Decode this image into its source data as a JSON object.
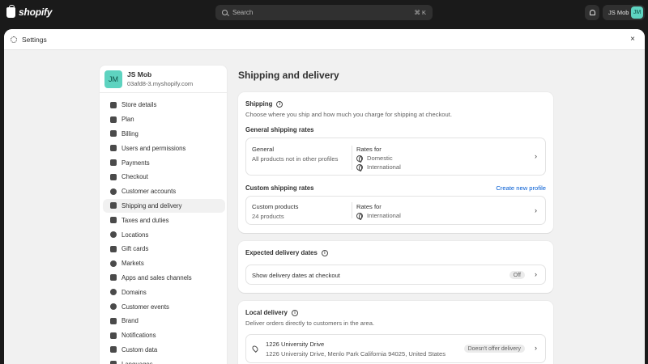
{
  "topbar": {
    "brand": "shopify",
    "search_placeholder": "Search",
    "search_shortcut": "⌘ K",
    "user_label": "JS Mob",
    "user_initials": "JM"
  },
  "modal": {
    "title": "Settings",
    "close": "×"
  },
  "sidebar": {
    "store": {
      "initials": "JM",
      "name": "JS Mob",
      "domain": "03afd8-3.myshopify.com"
    },
    "items": [
      {
        "label": "Store details",
        "icon": "store-icon"
      },
      {
        "label": "Plan",
        "icon": "plan-icon"
      },
      {
        "label": "Billing",
        "icon": "billing-icon"
      },
      {
        "label": "Users and permissions",
        "icon": "users-icon"
      },
      {
        "label": "Payments",
        "icon": "payments-icon"
      },
      {
        "label": "Checkout",
        "icon": "cart-icon"
      },
      {
        "label": "Customer accounts",
        "icon": "person-icon"
      },
      {
        "label": "Shipping and delivery",
        "icon": "truck-icon",
        "active": true
      },
      {
        "label": "Taxes and duties",
        "icon": "tax-icon"
      },
      {
        "label": "Locations",
        "icon": "location-icon"
      },
      {
        "label": "Gift cards",
        "icon": "gift-icon"
      },
      {
        "label": "Markets",
        "icon": "globe-icon"
      },
      {
        "label": "Apps and sales channels",
        "icon": "apps-icon"
      },
      {
        "label": "Domains",
        "icon": "globe-icon"
      },
      {
        "label": "Customer events",
        "icon": "events-icon"
      },
      {
        "label": "Brand",
        "icon": "brand-icon"
      },
      {
        "label": "Notifications",
        "icon": "bell-icon"
      },
      {
        "label": "Custom data",
        "icon": "data-icon"
      },
      {
        "label": "Languages",
        "icon": "language-icon"
      }
    ]
  },
  "main": {
    "title": "Shipping and delivery",
    "shipping": {
      "title": "Shipping",
      "subtitle": "Choose where you ship and how much you charge for shipping at checkout.",
      "general_title": "General shipping rates",
      "general": {
        "name": "General",
        "desc": "All products not in other profiles",
        "rates_label": "Rates for",
        "rates": [
          "Domestic",
          "International"
        ]
      },
      "custom_title": "Custom shipping rates",
      "create_link": "Create new profile",
      "custom": {
        "name": "Custom products",
        "desc": "24 products",
        "rates_label": "Rates for",
        "rates": [
          "International"
        ]
      }
    },
    "expected": {
      "title": "Expected delivery dates",
      "row_label": "Show delivery dates at checkout",
      "status": "Off"
    },
    "local": {
      "title": "Local delivery",
      "subtitle": "Deliver orders directly to customers in the area.",
      "location_name": "1226 University Drive",
      "location_address": "1226 University Drive, Menlo Park California 94025, United States",
      "status": "Doesn't offer delivery"
    }
  }
}
